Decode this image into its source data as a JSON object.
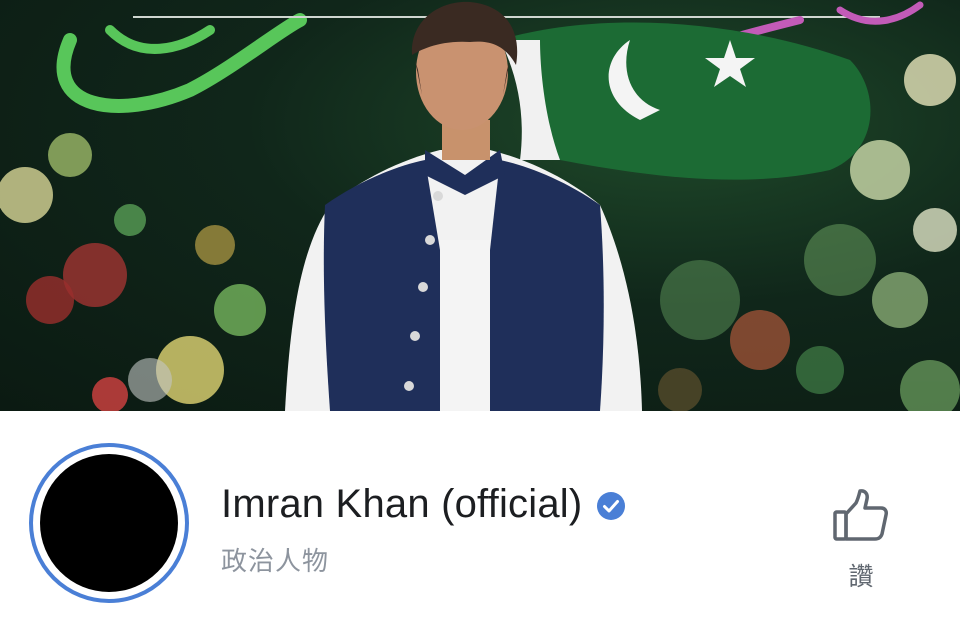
{
  "cover": {
    "icon": "cover-photo",
    "colors": {
      "flag_green": "#1c6b34",
      "vest_navy": "#1f2f5a",
      "kurta_white": "#f2f2f2"
    }
  },
  "profile": {
    "avatar_icon": "profile-picture",
    "ring_color": "#4a7fd6",
    "name": "Imran Khan (official)",
    "verified_icon": "verified-badge-icon",
    "verified_color": "#4a7fd6",
    "category": "政治人物"
  },
  "actions": {
    "like_icon": "thumbs-up-icon",
    "like_label": "讚"
  }
}
